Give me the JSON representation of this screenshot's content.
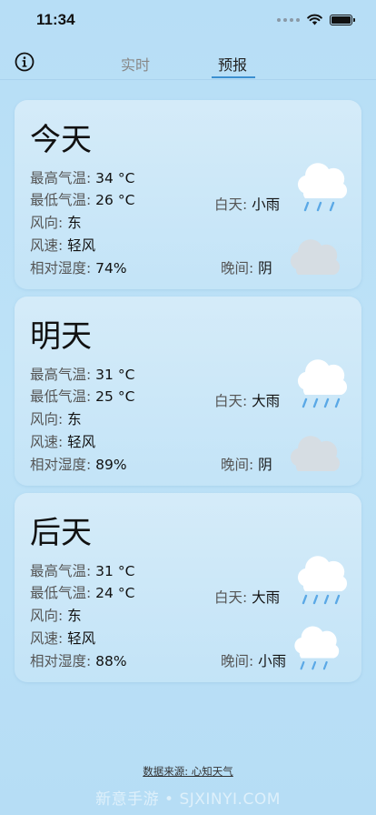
{
  "status_bar": {
    "time": "11:34"
  },
  "nav": {
    "tabs": [
      {
        "label": "实时",
        "active": false
      },
      {
        "label": "预报",
        "active": true
      }
    ],
    "accent_color": "#3b8fd0"
  },
  "labels": {
    "high": "最高气温:",
    "low": "最低气温:",
    "wind_dir": "风向:",
    "wind_speed": "风速:",
    "humidity": "相对湿度:",
    "day": "白天:",
    "night": "晚间:"
  },
  "forecast": [
    {
      "title": "今天",
      "high": "34 °C",
      "low": "26 °C",
      "wind_dir": "东",
      "wind_speed": "轻风",
      "humidity": "74%",
      "day_weather": "小雨",
      "night_weather": "阴",
      "day_icon": "light-rain-cloud-icon",
      "night_icon": "overcast-cloud-icon"
    },
    {
      "title": "明天",
      "high": "31 °C",
      "low": "25 °C",
      "wind_dir": "东",
      "wind_speed": "轻风",
      "humidity": "89%",
      "day_weather": "大雨",
      "night_weather": "阴",
      "day_icon": "heavy-rain-cloud-icon",
      "night_icon": "overcast-cloud-icon"
    },
    {
      "title": "后天",
      "high": "31 °C",
      "low": "24 °C",
      "wind_dir": "东",
      "wind_speed": "轻风",
      "humidity": "88%",
      "day_weather": "大雨",
      "night_weather": "小雨",
      "day_icon": "heavy-rain-cloud-icon",
      "night_icon": "light-rain-cloud-icon"
    }
  ],
  "footer": {
    "source": "数据来源: 心知天气"
  },
  "watermark": "新意手游 • SJXINYI.COM"
}
